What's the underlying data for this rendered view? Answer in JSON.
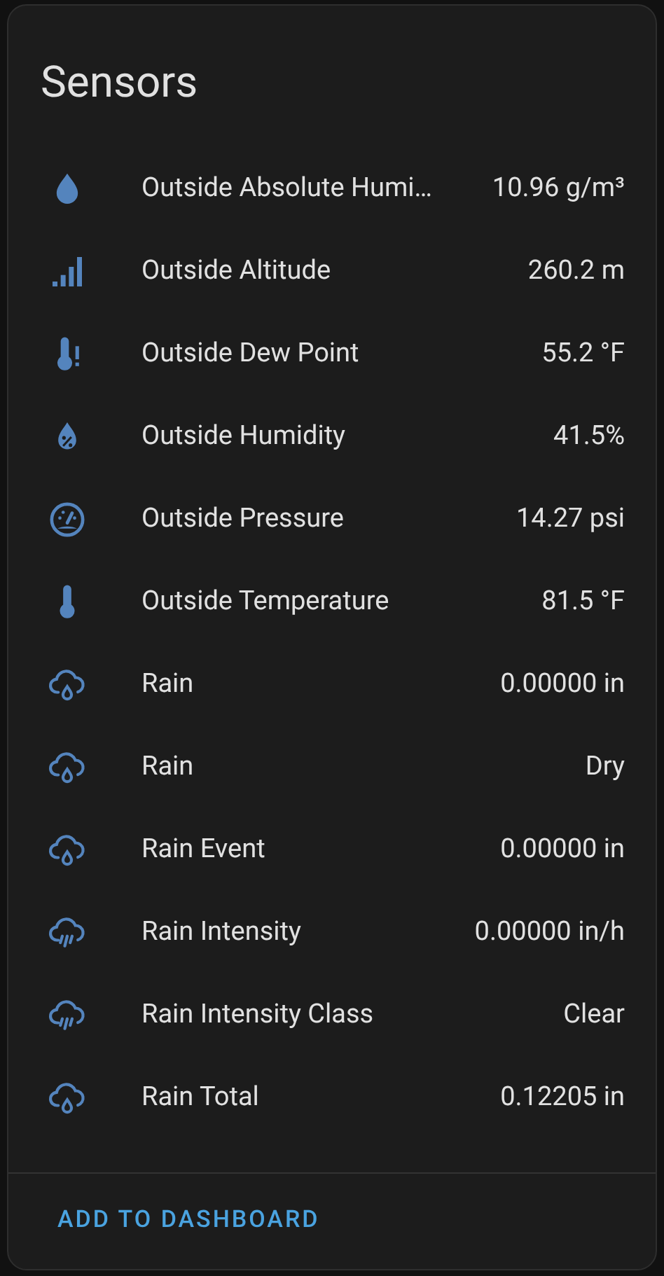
{
  "title": "Sensors",
  "rows": [
    {
      "kind": "drop",
      "name": "Outside Absolute Humi…",
      "value": "10.96 g/m³"
    },
    {
      "kind": "signal",
      "name": "Outside Altitude",
      "value": "260.2 m"
    },
    {
      "kind": "thermometer-alert",
      "name": "Outside Dew Point",
      "value": "55.2 °F"
    },
    {
      "kind": "drop-percent",
      "name": "Outside Humidity",
      "value": "41.5%"
    },
    {
      "kind": "gauge",
      "name": "Outside Pressure",
      "value": "14.27 psi"
    },
    {
      "kind": "thermometer",
      "name": "Outside Temperature",
      "value": "81.5 °F"
    },
    {
      "kind": "cloud-drop",
      "name": "Rain",
      "value": "0.00000 in"
    },
    {
      "kind": "cloud-drop",
      "name": "Rain",
      "value": "Dry"
    },
    {
      "kind": "cloud-drop",
      "name": "Rain Event",
      "value": "0.00000 in"
    },
    {
      "kind": "cloud-rain",
      "name": "Rain Intensity",
      "value": "0.00000 in/h"
    },
    {
      "kind": "cloud-rain",
      "name": "Rain Intensity Class",
      "value": "Clear"
    },
    {
      "kind": "cloud-drop",
      "name": "Rain Total",
      "value": "0.12205 in"
    }
  ],
  "button": "ADD TO DASHBOARD"
}
